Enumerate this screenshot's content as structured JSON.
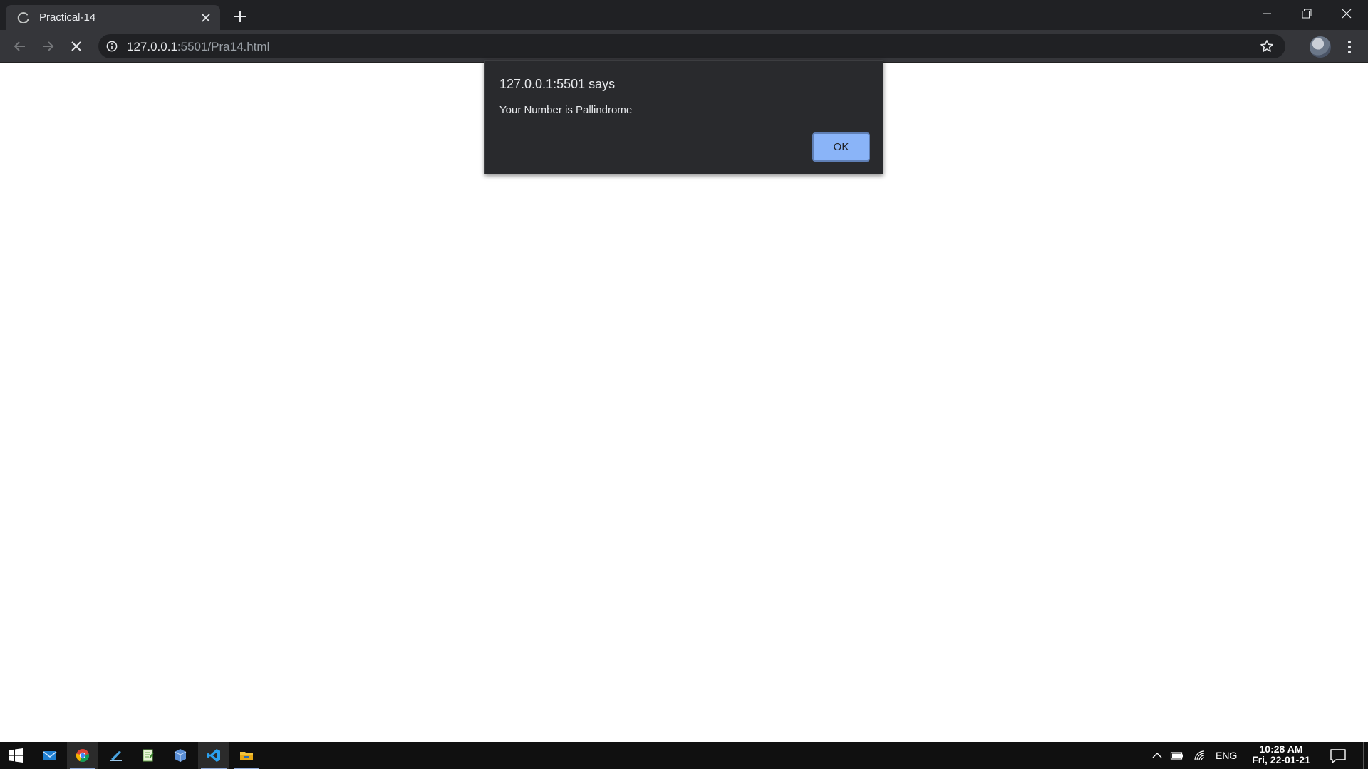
{
  "browser": {
    "tab": {
      "title": "Practical-14",
      "favicon": "loading-spinner-icon"
    },
    "url": {
      "host": "127.0.0.1",
      "rest": ":5501/Pra14.html"
    },
    "icons": {
      "back": "arrow-left-icon",
      "forward": "arrow-right-icon",
      "stop": "close-icon",
      "info": "info-icon",
      "bookmark": "star-icon",
      "menu": "vertical-dots-icon"
    }
  },
  "dialog": {
    "title": "127.0.0.1:5501 says",
    "message": "Your Number is Pallindrome",
    "ok_label": "OK"
  },
  "taskbar": {
    "apps": [
      "start-windows-icon",
      "mail-icon",
      "chrome-icon",
      "tool-icon",
      "notepad-icon",
      "box-icon",
      "vscode-icon",
      "file-explorer-icon"
    ],
    "language": "ENG",
    "time": "10:28 AM",
    "date": "Fri, 22-01-21"
  },
  "colors": {
    "tabstrip": "#202124",
    "toolbar": "#35363a",
    "dialog_bg": "#292a2d",
    "ok_button": "#8ab4f8",
    "taskbar": "#101010"
  }
}
